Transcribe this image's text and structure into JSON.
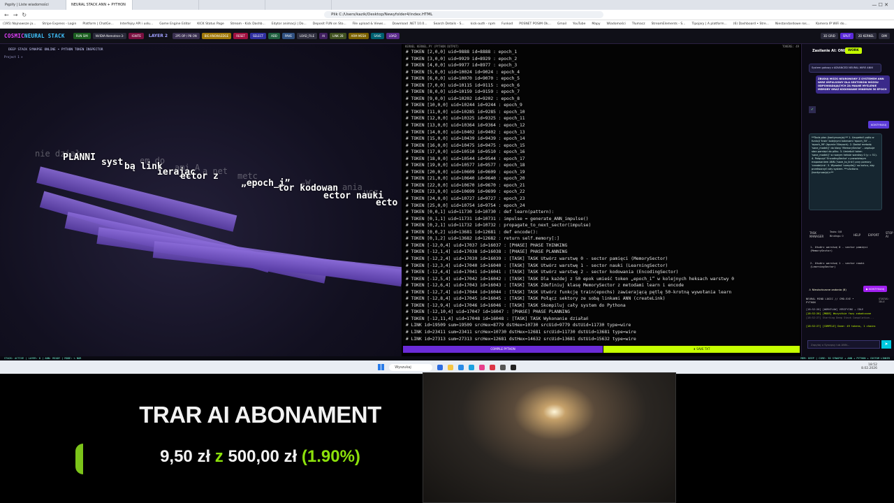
{
  "browser": {
    "tabs": [
      {
        "label": "Pępiły | Liste wiadomości"
      },
      {
        "label": "NEURAL STACK ANN + PYTHON"
      },
      {
        "label": ""
      },
      {
        "label": ""
      },
      {
        "label": ""
      }
    ],
    "url": "Plik   C:/Users/kazik/Desktop/Newyfolder4/index.HTML",
    "bookmarks": [
      "(195) Najnowsze ja...",
      "Stripe Express - Login",
      "Platform | ChatGe...",
      "Interfejsy API i usłu...",
      "Game Engine Editor",
      "KICK Status Page",
      "Stream - Kick Dashb...",
      "Edytor animacji | Do...",
      "Deposit FUN on Sto...",
      "File upload & Views...",
      "Download .NET 10.0...",
      "Search Details - S...",
      "kick-auth - npm",
      "Funkod",
      "POSNET POSIM Ok...",
      "Gmail",
      "YouTube",
      "Mapy",
      "Wiadomości",
      "Tłumacz",
      "StreamElements - S...",
      "Tipojary | A platform...",
      "(6) Dashboard • Stre...",
      "Niestandardowe ros...",
      "Kamera IP WiFi do..."
    ]
  },
  "app": {
    "brand_a": "COSMIC",
    "brand_b": "NEURAL STACK",
    "buttons": [
      "RUN SIM",
      "NVIDIA-Nemotron-3-",
      "IGNITE",
      "LAYER 2",
      "2P5 OP / P8 ON",
      "BIG KNOWLEDGE",
      "RESET",
      "SELECT",
      "ADD",
      "PAVE",
      "LOAD_FILE",
      "AI",
      "LINK 2B",
      "ARM MESH",
      "SAVE",
      "LOAD"
    ],
    "layer": "LAYER 2",
    "right_buttons": [
      "3D GRID",
      "SPLIT",
      "2D KERNEL",
      "DIM"
    ],
    "colors": {
      "brand": "#e040fb",
      "accent": "#c6ff00",
      "purple": "#6a2bd8"
    }
  },
  "pane3d": {
    "title": "DEEP STACK SYNAPSE ONLINE • PYTHON TOKEN INSPECTOR",
    "project_tab": "Project 1  ×",
    "words": [
      "PLANNI",
      "syst",
      "bą link",
      "ierając",
      "ector z",
      "„epoch_i”",
      "tor kodowan",
      "ector nauki",
      "ecto"
    ],
    "ghost_words": [
      "nie dział",
      "em do",
      "ami A",
      "a net",
      "metc",
      "„w",
      "ania",
      "ucz"
    ]
  },
  "console": {
    "title": "KERNEL KERNEL.PY (PYTHON OUTPUT)",
    "tokens_label": "TOKENS: 49",
    "lines": [
      "# TOKEN [2,0,0] uid=9888 id=8888 : epoch_1",
      "# TOKEN [3,0,0] uid=9929 id=8929 : epoch_2",
      "# TOKEN [4,0,0] uid=9977 id=8977 : epoch_3",
      "# TOKEN [5,0,0] uid=10024 id=9024 : epoch_4",
      "# TOKEN [6,0,0] uid=10070 id=9070 : epoch_5",
      "# TOKEN [7,0,0] uid=10115 id=9115 : epoch_6",
      "# TOKEN [8,0,0] uid=10159 id=9159 : epoch_7",
      "# TOKEN [9,0,0] uid=10202 id=9202 : epoch_8",
      "# TOKEN [10,0,0] uid=10244 id=9244 : epoch_9",
      "# TOKEN [11,0,0] uid=10285 id=9285 : epoch_10",
      "# TOKEN [12,0,0] uid=10325 id=9325 : epoch_11",
      "# TOKEN [13,0,0] uid=10364 id=9364 : epoch_12",
      "# TOKEN [14,0,0] uid=10402 id=9402 : epoch_13",
      "# TOKEN [15,0,0] uid=10439 id=9439 : epoch_14",
      "# TOKEN [16,0,0] uid=10475 id=9475 : epoch_15",
      "# TOKEN [17,0,0] uid=10510 id=9510 : epoch_16",
      "# TOKEN [18,0,0] uid=10544 id=9544 : epoch_17",
      "# TOKEN [19,0,0] uid=10577 id=9577 : epoch_18",
      "# TOKEN [20,0,0] uid=10609 id=9609 : epoch_19",
      "# TOKEN [21,0,0] uid=10640 id=9640 : epoch_20",
      "# TOKEN [22,0,0] uid=10670 id=9670 : epoch_21",
      "# TOKEN [23,0,0] uid=10699 id=9699 : epoch_22",
      "# TOKEN [24,0,0] uid=10727 id=9727 : epoch_23",
      "# TOKEN [25,0,0] uid=10754 id=9754 : epoch_24",
      "# TOKEN [0,0,1] uid=11730 id=10730 : def learn(pattern):",
      "# TOKEN [0,1,1] uid=11731 id=10731 : impulse = generate_ANN_impulse()",
      "# TOKEN [0,2,1] uid=11732 id=10732 : propagate_to_next_sector(impulse)",
      "# TOKEN [0,0,2] uid=13681 id=12681 : def encode():",
      "# TOKEN [0,1,2] uid=13682 id=12682 : return self.memory[:]",
      "# TOKEN [-12,0,4] uid=17037 id=16037 : [PHASE] PHASE THINKING",
      "# TOKEN [-12,1,4] uid=17038 id=16038 : [PHASE] PHASE PLANNING",
      "# TOKEN [-12,2,4] uid=17039 id=16039 : [TASK] TASK Utwórz warstwę 0 - sector pamięci (MemorySector)",
      "# TOKEN [-12,3,4] uid=17040 id=16040 : [TASK] TASK Utwórz warstwę 1 - sector nauki (LearningSector)",
      "# TOKEN [-12,4,4] uid=17041 id=16041 : [TASK] TASK Utwórz warstwę 2 - sector kodowania (EncodingSector)",
      "# TOKEN [-12,5,4] uid=17042 id=16042 : [TASK] TASK Dla każdej z 50 epok umieść token „epoch_i” w kolejnych heksach warstwy 0",
      "# TOKEN [-12,6,4] uid=17043 id=16043 : [TASK] TASK Zdefiniuj klasę MemorySector z metodami learn i encode",
      "# TOKEN [-12,7,4] uid=17044 id=16044 : [TASK] TASK Utwórz funkcję train(epochs) zawierającą pętlę 50-krotną wywołania learn",
      "# TOKEN [-12,8,4] uid=17045 id=16045 : [TASK] TASK Połącz sektory ze sobą linkami ANN (createLink)",
      "# TOKEN [-12,9,4] uid=17046 id=16046 : [TASK] TASK Skompiluj cały system do Pythona",
      "# TOKEN [-12,10,4] uid=17047 id=16047 : [PHASE] PHASE PLANNING",
      "# TOKEN [-12,11,4] uid=17048 id=16048 : [TASK] TASK Wykonanie działań",
      "# LINK id=19509 sum=19509 srcHex=8779 dstHex=10730 srcUid=9779 dstUid=11730 type=wire",
      "# LINK id=23411 sum=23411 srcHex=10730 dstHex=12681 srcUid=11730 dstUid=13681 type=wire",
      "# LINK id=27313 sum=27313 srcHex=12681 dstHex=14632 srcUid=13681 dstUid=15632 type=wire"
    ],
    "compile_label": "COMPILE PYTHON",
    "save_label": "⬇ SAVE TXT"
  },
  "chat": {
    "title": "Zasilanie AI: ONLINE",
    "mode": "WORK",
    "system_msg": "System gotowy z ADVANCED NEURAL WIRE ANN!",
    "user_msg": "ZBUDUJ MÓZG NEURONOWY Z SYSTEMEM ANN WIRE IMPULSOWY DLA SEKTORÓW MÓZGU ODPOWIADAJĄCYCH ZA MAŁNE MYŚLENIE MEMORY ORAZ KODOWANIE MINIMUM 50 EPOCH",
    "check": "✓",
    "continue_btn": "KONTYNUUJ",
    "assistant_msg": "**Tools plan (kontynuacja):** 1. Uzupełnić pętlę w funkcji 'train' kolejnymi tokenami 'epoch_50' ... 'epoch_99' (łącznie 50epoch). 2. Dodać metodę 'save_model()' do klasy 'MemorySector' – zapisuje stan pamięci do pliku. 3. Umieścić token 'save_model()' w nowym heksie warstwy 0 (y = 51). 4. Połączyć 'EncodingSector' z prawdziwym mapowaniem ANN ('save_to_link') przy pomocy 'createLink'. 5. Wywołać 'compile()' na końcu, aby przetworzyć cały system. **<Actions (kontynuacja)>**",
    "task_manager": "TASK MANAGER",
    "task_tasks": "Tasks: 0/8",
    "bindings": "Bindings: 0",
    "help": "HELP",
    "export": "EXPORT",
    "stop": "STOP AI",
    "tasks": [
      "1. Utwórz warstwę 0 - sector pamięci (MemorySector)",
      "2. Utwórz warstwę 1 - sector nauki (LearningSector)"
    ],
    "pending": "⚠ Nieukończone zadania (8)",
    "pending_btn": "▶ KONTYNUUJ",
    "log_title": "NEURAL MIND LOGIC // CMD.EXE • PYTHON",
    "log_status": "STATUS: IDLE",
    "log": [
      "[18:52:26] [WORKFLOW] VERIFYING → IDLE",
      "[18:52:26] [MODE] Wszystkie fazy zakończone",
      "[18:52:27] Starting Deep Stack Compilation...",
      "[18:52:27] [COMPILE] Done: 49 tokens, 1 chains"
    ],
    "input_placeholder": "Zapytaj o Synapsy lub ANN...",
    "send": "➤"
  },
  "statusbar": {
    "left": "STACK: ACTIVE | LAYER: 0 | ANN: READY | MODE: ✎ NOR",
    "right": "MEM: DEEP | CORE: 3D SYNAPSE + ANN + PYTHON + CUSTOM LINKER"
  },
  "taskbar": {
    "search": "Wyszukaj",
    "time": "18:52",
    "date": "8.02.2026"
  },
  "overlay": {
    "subtitle": "TRAR AI ABONAMENT",
    "current": "9,50 zł",
    "z": "z",
    "goal": "500,00 zł",
    "percent": "(1.90%)",
    "progress": 0.019
  }
}
